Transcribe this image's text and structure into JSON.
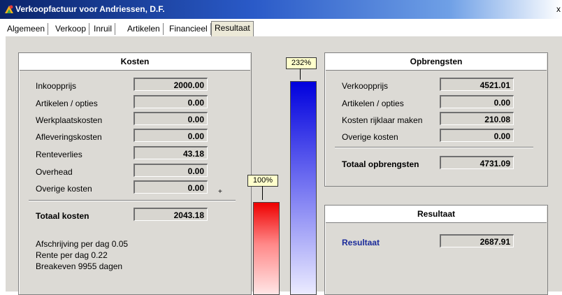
{
  "window": {
    "title": "Verkoopfactuur voor Andriessen, D.F.",
    "close_glyph": "x"
  },
  "tabs": [
    {
      "label": "Algemeen"
    },
    {
      "label": "Verkoop"
    },
    {
      "label": "Inruil"
    },
    {
      "label": "Artikelen"
    },
    {
      "label": "Financieel"
    },
    {
      "label": "Resultaat",
      "active": true
    }
  ],
  "kosten": {
    "title": "Kosten",
    "rows": [
      {
        "label": "Inkoopprijs",
        "value": "2000.00"
      },
      {
        "label": "Artikelen / opties",
        "value": "0.00"
      },
      {
        "label": "Werkplaatskosten",
        "value": "0.00"
      },
      {
        "label": "Afleveringskosten",
        "value": "0.00"
      },
      {
        "label": "Renteverlies",
        "value": "43.18"
      },
      {
        "label": "Overhead",
        "value": "0.00"
      },
      {
        "label": "Overige kosten",
        "value": "0.00"
      }
    ],
    "plus_marker": "+",
    "total_label": "Totaal kosten",
    "total_value": "2043.18",
    "notes": [
      "Afschrijving per dag 0.05",
      "Rente per dag 0.22",
      "Breakeven 9955 dagen"
    ]
  },
  "bars": {
    "costs": {
      "label": "100%",
      "percent": 100,
      "color": "#ee0000"
    },
    "revenue": {
      "label": "232%",
      "percent": 232,
      "color": "#0000dd"
    }
  },
  "opbrengsten": {
    "title": "Opbrengsten",
    "rows": [
      {
        "label": "Verkoopprijs",
        "value": "4521.01"
      },
      {
        "label": "Artikelen / opties",
        "value": "0.00"
      },
      {
        "label": "Kosten rijklaar maken",
        "value": "210.08"
      },
      {
        "label": "Overige kosten",
        "value": "0.00"
      }
    ],
    "total_label": "Totaal opbrengsten",
    "total_value": "4731.09"
  },
  "resultaat": {
    "title": "Resultaat",
    "label": "Resultaat",
    "value": "2687.91",
    "label_color": "#1a2a9a"
  }
}
